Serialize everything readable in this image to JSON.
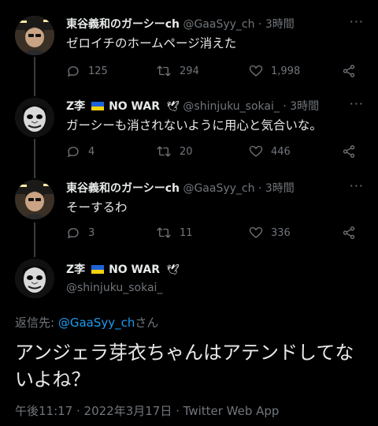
{
  "tweets": [
    {
      "name": "東谷義和のガーシーch",
      "handle": "@GaaSyy_ch",
      "dot": "·",
      "time": "3時間",
      "text": "ゼロイチのホームページ消えた",
      "replies": "125",
      "retweets": "294",
      "likes": "1,998"
    },
    {
      "name": "Z李",
      "badge": "NO WAR",
      "handle": "@shinjuku_sokai_",
      "dot": "·",
      "time": "3時間",
      "text": "ガーシーも消されないように用心と気合いな。",
      "replies": "4",
      "retweets": "20",
      "likes": "446"
    },
    {
      "name": "東谷義和のガーシーch",
      "handle": "@GaaSyy_ch",
      "dot": "·",
      "time": "3時間",
      "text": "そーするわ",
      "replies": "3",
      "retweets": "11",
      "likes": "336"
    }
  ],
  "main": {
    "name": "Z李",
    "badge": "NO WAR",
    "handle": "@shinjuku_sokai_",
    "reply_prefix": "返信先: ",
    "reply_mention": "@GaaSyy_ch",
    "reply_suffix": "さん",
    "text": "アンジェラ芽衣ちゃんはアテンドしてないよね？",
    "meta": "午後11:17 · 2022年3月17日 · Twitter Web App"
  },
  "more_label": "···",
  "colors": {
    "background": "#000000",
    "muted": "#71767b",
    "link": "#1d9bf0",
    "flag_blue": "#1e63d6",
    "flag_yellow": "#f4d20a"
  }
}
